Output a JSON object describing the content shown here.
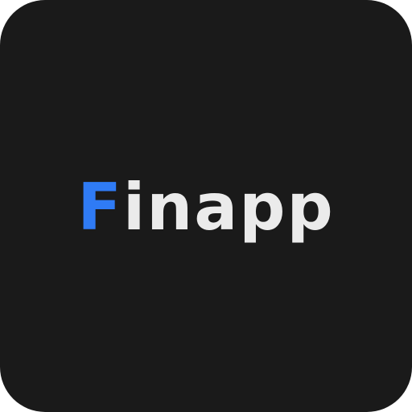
{
  "icon": {
    "background": "#1a1a1a"
  },
  "logo": {
    "first_letter": "F",
    "rest": "inapp",
    "accent_color": "#2f7bf5",
    "text_color": "#ebebeb"
  }
}
